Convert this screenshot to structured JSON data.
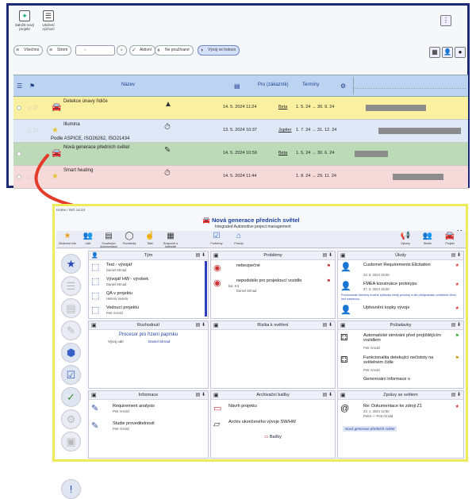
{
  "top_window": {
    "toolbar": {
      "new_project_label": "Založit nový projekt",
      "save_filter_label": "Uložení výchozí"
    },
    "filters": {
      "all_label": "Všechno",
      "tree_label": "Strom",
      "search_placeholder": "",
      "active_label": "Aktivní",
      "unused_label": "Ne používané",
      "in_progress_label": "Vývoj ve hotovo"
    },
    "grid": {
      "columns": {
        "name": "Název",
        "customer": "Pro (zákazník)",
        "terms": "Termíny"
      },
      "rows": [
        {
          "name": "Detekce únavy řidiče",
          "date": "14. 5. 2024 11:24",
          "customer": "Beta",
          "terms": "1. 5. 24 → 30. 9. 24",
          "bg": "#fbefa0"
        },
        {
          "name": "Illumina",
          "sub": "Podle ASPICE, ISO26262, ISO21434",
          "date": "13. 5. 2024 10:37",
          "customer": "Jupiter",
          "terms": "1. 7. 24 → 31. 12. 24",
          "bg": "#dfe8f6"
        },
        {
          "name": "Nová generace předních světel",
          "date": "14. 5. 2024 10:59",
          "customer": "Beta",
          "terms": "1. 5. 24 → 30. 6. 24",
          "bg": "#bcd9b8"
        },
        {
          "name": "Smart heating",
          "date": "14. 5. 2024 11:44",
          "customer": "",
          "terms": "1. 8. 24 → 29. 11. 24",
          "bg": "#f6d9d9"
        }
      ]
    }
  },
  "bottom_window": {
    "window_title": "Home / ISO 14:24",
    "project_title": "Nová generace předních světel",
    "project_subtitle": "Integrated Automotive project management",
    "toolbar": [
      "Zkrácené info",
      "Lidé",
      "Související dokumentace",
      "Poznámky",
      "Také",
      "Rozpočet a kalendář",
      "Problémy",
      "Postup"
    ],
    "toolbar_right": [
      "Výkony",
      "Studie",
      "Projekt"
    ],
    "panels": {
      "tym": {
        "title": "Tým",
        "items": [
          {
            "title": "Test - vývojář",
            "person": "Daniel Strnad"
          },
          {
            "title": "Vývojář HW - výrobek",
            "person": "Daniel Strnad"
          },
          {
            "title": "QA v projektu",
            "person": "Helena Vesela"
          },
          {
            "title": "Vedoucí projektu",
            "person": "Petr Arnold"
          }
        ]
      },
      "problemy": {
        "title": "Problémy",
        "items": [
          {
            "title": "nebezpečné"
          },
          {
            "title": "nepodobilo pro projedoucí vozidlo",
            "sub": "kat. K3",
            "person": "Daniel Strnad"
          }
        ]
      },
      "ukoly": {
        "title": "Úkoly",
        "items": [
          {
            "title": "Customer Requirements Elicitation",
            "date": "23. 5. 2024 15:00"
          },
          {
            "title": "FMEA konstrukce prototypu",
            "date": "27. 5. 2024 15:00"
          },
          {
            "title": "Upřesnění kopky vývoje"
          }
        ],
        "note": "Prozkoumat všechny možné způsoby cesty procesy a dle předpokladu problémů dříve, než nastanou."
      },
      "rozhodnuti": {
        "title": "Rozhodnutí",
        "item_title": "Procesor pro řízení paprsku",
        "item_meta": "Vývoj ode",
        "item_person": "Daniel Strnad"
      },
      "rizika": {
        "title": "Rizika k ověření"
      },
      "pozadavky": {
        "title": "Požadavky",
        "items": [
          {
            "title": "Automatické stmívání před projíždějícím vozidlem",
            "person": "Petr Arnold"
          },
          {
            "title": "Funkcionalita detekující nečistoty na světelném čidle",
            "person": "Petr Arnold"
          },
          {
            "title": "Generování informace o"
          }
        ]
      },
      "informace": {
        "title": "Informace",
        "items": [
          {
            "title": "Requirement analysis",
            "person": "Petr Arnold"
          },
          {
            "title": "Studie proveditelnosti",
            "person": "Petr Arnold"
          }
        ]
      },
      "archivacni": {
        "title": "Archivační balíky",
        "items": [
          {
            "title": "Návrh projektu"
          },
          {
            "title": "Archiv ukončeného vývoje SW/HW"
          }
        ],
        "footer": "Balíky"
      },
      "zpravy": {
        "title": "Zprávy se světem",
        "item_title": "Re: Dokumentace ke zdroji Z1",
        "item_date": "23. 1. 2024 12:50",
        "item_from": "Petra — Petr Arnold",
        "link": "Nová generace předních světel"
      }
    }
  }
}
